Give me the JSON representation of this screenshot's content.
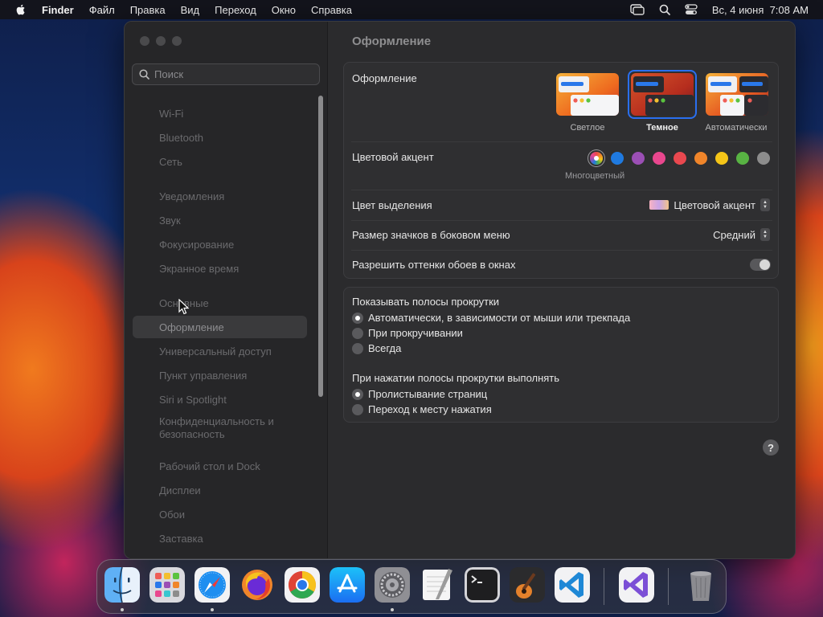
{
  "menubar": {
    "app": "Finder",
    "items": [
      "Файл",
      "Правка",
      "Вид",
      "Переход",
      "Окно",
      "Справка"
    ],
    "clock": "Вс, 4 июня  7:08 AM"
  },
  "sidebar": {
    "search_placeholder": "Поиск",
    "items": [
      "Wi-Fi",
      "Bluetooth",
      "Сеть",
      "Уведомления",
      "Звук",
      "Фокусирование",
      "Экранное время",
      "Основные",
      "Оформление",
      "Универсальный доступ",
      "Пункт управления",
      "Siri и Spotlight",
      "Конфиденциальность и безопасность",
      "Рабочий стол и Dock",
      "Дисплеи",
      "Обои",
      "Заставка"
    ],
    "selected": "Оформление"
  },
  "content": {
    "title": "Оформление",
    "appearance": {
      "label": "Оформление",
      "options": [
        "Светлое",
        "Темное",
        "Автоматически"
      ],
      "selected": "Темное"
    },
    "accent": {
      "label": "Цветовой акцент",
      "caption": "Многоцветный",
      "colors": [
        "multicolor",
        "#1f7ae0",
        "#9b4fb5",
        "#e9478e",
        "#e9484f",
        "#f0852a",
        "#f5c518",
        "#58b343",
        "#8c8c8c"
      ]
    },
    "highlight": {
      "label": "Цвет выделения",
      "value": "Цветовой акцент"
    },
    "icon_size": {
      "label": "Размер значков в боковом меню",
      "value": "Средний"
    },
    "wallpaper_tint": {
      "label": "Разрешить оттенки обоев в окнах",
      "enabled": true
    },
    "scrollbars": {
      "label": "Показывать полосы прокрутки",
      "options": [
        "Автоматически, в зависимости от мыши или трекпада",
        "При прокручивании",
        "Всегда"
      ],
      "selected": 0
    },
    "click_scrollbar": {
      "label": "При нажатии полосы прокрутки выполнять",
      "options": [
        "Пролистывание страниц",
        "Переход к месту нажатия"
      ],
      "selected": 0
    },
    "help": "?"
  },
  "dock": {
    "apps": [
      "finder-icon",
      "launchpad-icon",
      "safari-icon",
      "firefox-icon",
      "chrome-icon",
      "app-store-icon",
      "system-settings-icon",
      "textedit-icon",
      "terminal-icon",
      "garageband-icon",
      "vscode-icon",
      "visual-studio-icon",
      "trash-icon"
    ]
  }
}
